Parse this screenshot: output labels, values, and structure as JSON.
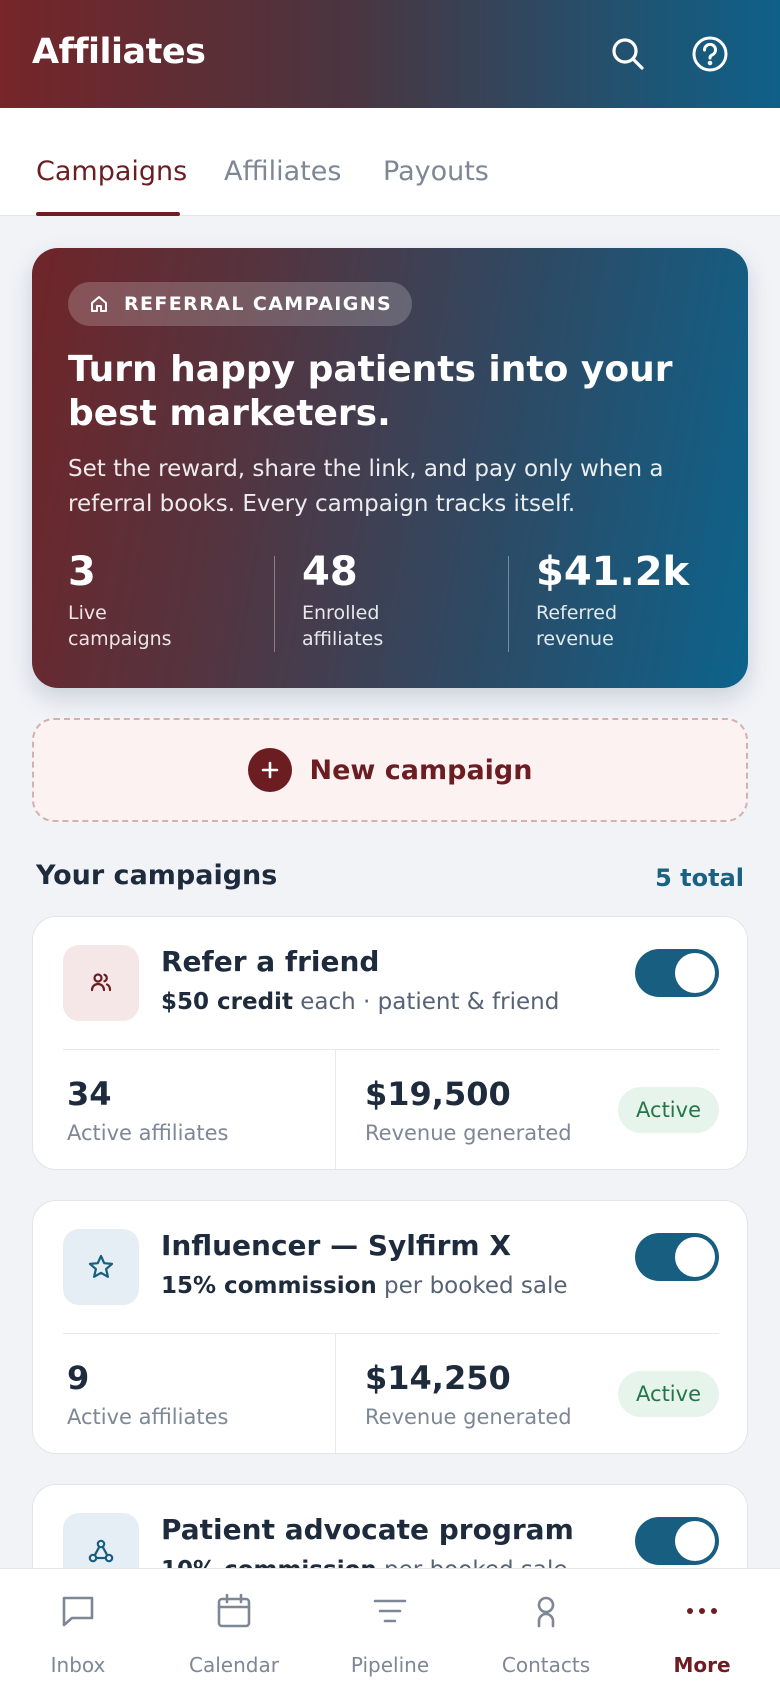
{
  "header": {
    "title": "Affiliates"
  },
  "tabs": [
    {
      "label": "Campaigns",
      "active": true
    },
    {
      "label": "Affiliates",
      "active": false
    },
    {
      "label": "Payouts",
      "active": false
    }
  ],
  "hero": {
    "badge": "REFERRAL CAMPAIGNS",
    "title": "Turn happy patients into your best marketers.",
    "description": "Set the reward, share the link, and pay only when a referral books. Every campaign tracks itself.",
    "stats": [
      {
        "value": "3",
        "label": "Live campaigns"
      },
      {
        "value": "48",
        "label": "Enrolled affiliates"
      },
      {
        "value": "$41.2k",
        "label": "Referred revenue"
      }
    ]
  },
  "new_campaign": {
    "label": "New campaign"
  },
  "section": {
    "title": "Your campaigns",
    "count": "5 total"
  },
  "campaigns": [
    {
      "name": "Refer a friend",
      "reward_bold": "$50 credit",
      "reward_rest": " each · patient & friend",
      "icon": "users-icon",
      "enabled": true,
      "affiliates": "34",
      "affiliates_label": "Active affiliates",
      "revenue": "$19,500",
      "revenue_label": "Revenue generated",
      "status": "Active"
    },
    {
      "name": "Influencer — Sylfirm X",
      "reward_bold": "15% commission",
      "reward_rest": " per booked sale",
      "icon": "star-icon",
      "enabled": true,
      "affiliates": "9",
      "affiliates_label": "Active affiliates",
      "revenue": "$14,250",
      "revenue_label": "Revenue generated",
      "status": "Active"
    },
    {
      "name": "Patient advocate program",
      "reward_bold": "10% commission",
      "reward_rest": " per booked sale",
      "icon": "network-icon",
      "enabled": true
    }
  ],
  "bottom_nav": [
    {
      "label": "Inbox",
      "icon": "chat-icon",
      "active": false
    },
    {
      "label": "Calendar",
      "icon": "calendar-icon",
      "active": false
    },
    {
      "label": "Pipeline",
      "icon": "filter-icon",
      "active": false
    },
    {
      "label": "Contacts",
      "icon": "person-icon",
      "active": false
    },
    {
      "label": "More",
      "icon": "more-icon",
      "active": true
    }
  ],
  "colors": {
    "brand_maroon": "#6c1d22",
    "brand_teal": "#175e80",
    "active_green": "#247548"
  }
}
